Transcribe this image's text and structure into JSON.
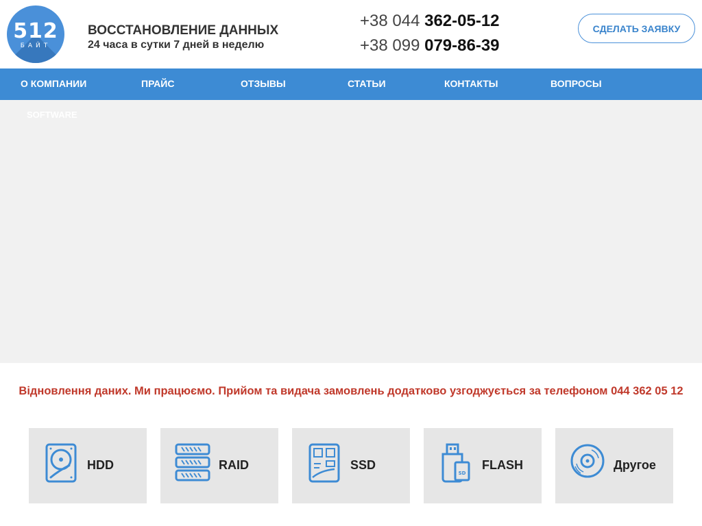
{
  "header": {
    "logo": {
      "number": "512",
      "sub": "БАЙТ"
    },
    "title": "ВОССТАНОВЛЕНИЕ ДАННЫХ",
    "subtitle": "24 часа в сутки 7 дней в неделю",
    "phones": [
      {
        "code": "+38 044",
        "number": "362-05-12"
      },
      {
        "code": "+38 099",
        "number": "079-86-39"
      }
    ],
    "cta_label": "СДЕЛАТЬ ЗАЯВКУ"
  },
  "nav": {
    "items": [
      {
        "label": "О КОМПАНИИ"
      },
      {
        "label": "ПРАЙС"
      },
      {
        "label": "ОТЗЫВЫ"
      },
      {
        "label": "СТАТЬИ"
      },
      {
        "label": "КОНТАКТЫ"
      },
      {
        "label": "ВОПРОСЫ"
      }
    ],
    "sub_item": "SOFTWARE"
  },
  "notice": "Відновлення даних. Ми працюємо. Прийом та видача замовлень додатково узгоджується за телефоном 044 362 05 12",
  "tiles": [
    {
      "label": "HDD",
      "icon": "hdd-icon"
    },
    {
      "label": "RAID",
      "icon": "raid-icon"
    },
    {
      "label": "SSD",
      "icon": "ssd-icon"
    },
    {
      "label": "FLASH",
      "icon": "flash-icon"
    },
    {
      "label": "Другое",
      "icon": "disc-icon"
    }
  ],
  "colors": {
    "accent": "#3d8bd4",
    "notice": "#c0392b",
    "tile_bg": "#e6e6e6",
    "banner_bg": "#f1f1f1"
  }
}
